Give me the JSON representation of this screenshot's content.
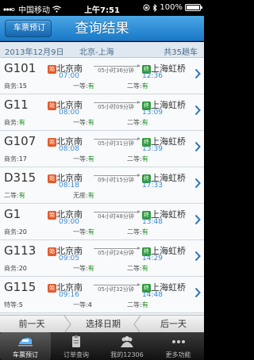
{
  "status": {
    "carrier": "中国移动",
    "time": "上午7:51",
    "battery": "100%"
  },
  "header": {
    "back_label": "车票预订",
    "title": "查询结果"
  },
  "summary": {
    "date": "2013年12月9日",
    "route": "北京-上海",
    "count": "共35趟车"
  },
  "badges": {
    "start": "始",
    "end": "终"
  },
  "trains": [
    {
      "no": "G101",
      "from": "北京南",
      "dep": "07:00",
      "duration": "05小时36分钟",
      "to": "上海虹桥",
      "arr": "12:36",
      "seat1_label": "商务:",
      "seat1": "15",
      "seat2_label": "一等:",
      "seat2": "有",
      "seat3_label": "二等:",
      "seat3": "有"
    },
    {
      "no": "G11",
      "from": "北京南",
      "dep": "08:00",
      "duration": "05小时09分钟",
      "to": "上海虹桥",
      "arr": "13:09",
      "seat1_label": "商务:",
      "seat1": "有",
      "seat2_label": "一等:",
      "seat2": "有",
      "seat3_label": "二等:",
      "seat3": "有"
    },
    {
      "no": "G107",
      "from": "北京南",
      "dep": "08:08",
      "duration": "05小时31分钟",
      "to": "上海虹桥",
      "arr": "13:39",
      "seat1_label": "商务:",
      "seat1": "17",
      "seat2_label": "一等:",
      "seat2": "有",
      "seat3_label": "二等:",
      "seat3": "有"
    },
    {
      "no": "D315",
      "from": "北京南",
      "dep": "08:18",
      "duration": "09小时15分钟",
      "to": "上海虹桥",
      "arr": "17:33",
      "seat1_label": "二等:",
      "seat1": "有",
      "seat2_label": "无座:",
      "seat2": "有",
      "seat3_label": "",
      "seat3": ""
    },
    {
      "no": "G1",
      "from": "北京南",
      "dep": "09:00",
      "duration": "04小时48分钟",
      "to": "上海虹桥",
      "arr": "13:48",
      "seat1_label": "商务:",
      "seat1": "20",
      "seat2_label": "一等:",
      "seat2": "有",
      "seat3_label": "二等:",
      "seat3": "有"
    },
    {
      "no": "G113",
      "from": "北京南",
      "dep": "09:05",
      "duration": "05小时24分钟",
      "to": "上海虹桥",
      "arr": "14:29",
      "seat1_label": "商务:",
      "seat1": "20",
      "seat2_label": "一等:",
      "seat2": "有",
      "seat3_label": "二等:",
      "seat3": "有"
    },
    {
      "no": "G115",
      "from": "北京南",
      "dep": "09:16",
      "duration": "05小时32分钟",
      "to": "上海虹桥",
      "arr": "14:48",
      "seat1_label": "特等:",
      "seat1": "5",
      "seat2_label": "一等:",
      "seat2": "4",
      "seat3_label": "二等:",
      "seat3": "有"
    }
  ],
  "datebar": {
    "prev": "前一天",
    "pick": "选择日期",
    "next": "后一天"
  },
  "tabs": [
    {
      "label": "车票预订",
      "icon": "train-icon",
      "active": true
    },
    {
      "label": "订单查询",
      "icon": "clipboard-icon",
      "active": false
    },
    {
      "label": "我的12306",
      "icon": "user-group-icon",
      "active": false
    },
    {
      "label": "更多功能",
      "icon": "more-dots-icon",
      "active": false
    }
  ],
  "colors": {
    "header_blue": "#2a8ad6",
    "link_blue": "#3c8ad0",
    "available_green": "#1b8a1b",
    "badge_start": "#e25b2a",
    "badge_end": "#2f9a3a"
  }
}
